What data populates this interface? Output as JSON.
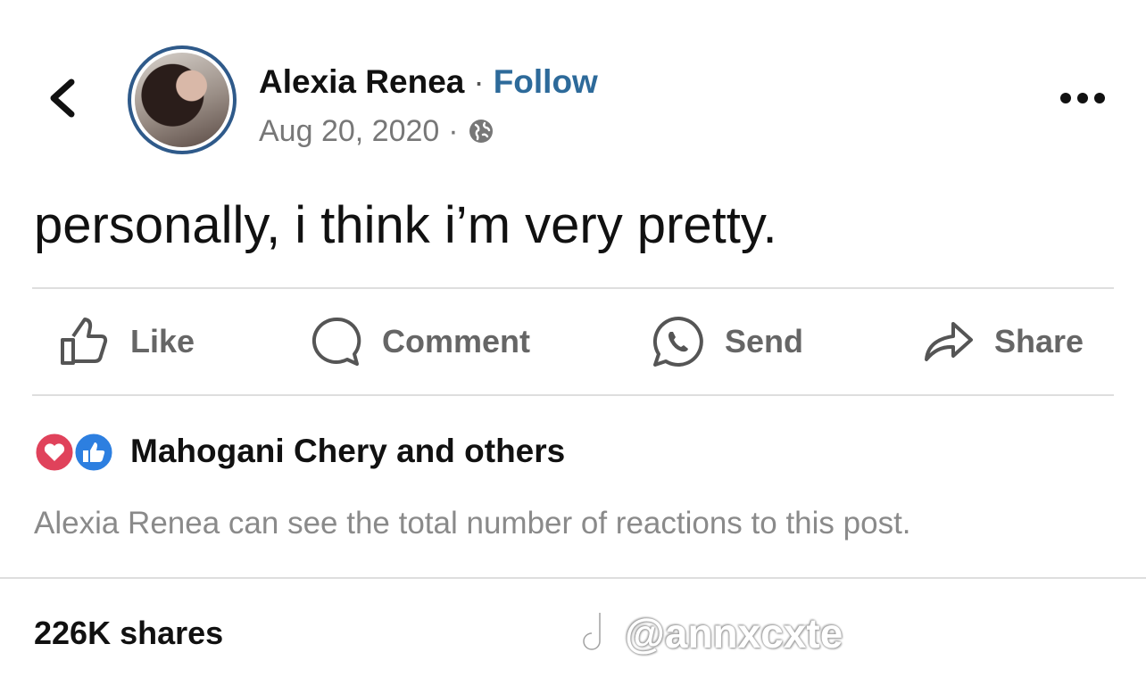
{
  "header": {
    "author_name": "Alexia Renea",
    "separator": "·",
    "follow_label": "Follow",
    "date": "Aug 20, 2020",
    "audience_icon": "globe-icon",
    "back_icon": "chevron-left-icon",
    "more_icon": "more-horizontal-icon"
  },
  "post": {
    "text": "personally, i think i’m very pretty."
  },
  "actions": [
    {
      "label": "Like",
      "icon": "thumbs-up-icon"
    },
    {
      "label": "Comment",
      "icon": "comment-bubble-icon"
    },
    {
      "label": "Send",
      "icon": "whatsapp-icon"
    },
    {
      "label": "Share",
      "icon": "share-arrow-icon"
    }
  ],
  "reactions": {
    "icons": [
      "love-reaction-icon",
      "like-reaction-icon"
    ],
    "summary": "Mahogani Chery and others",
    "note": "Alexia Renea can see the total number of reactions to this post."
  },
  "shares": {
    "label": "226K shares"
  },
  "watermark": {
    "text": "@annxcxte",
    "icon": "tiktok-icon"
  },
  "colors": {
    "accent": "#2d6a9a",
    "avatar_ring": "#2f5a8a",
    "love": "#e0425b",
    "like": "#2d7fe0",
    "muted_text": "#8a8a8a"
  }
}
